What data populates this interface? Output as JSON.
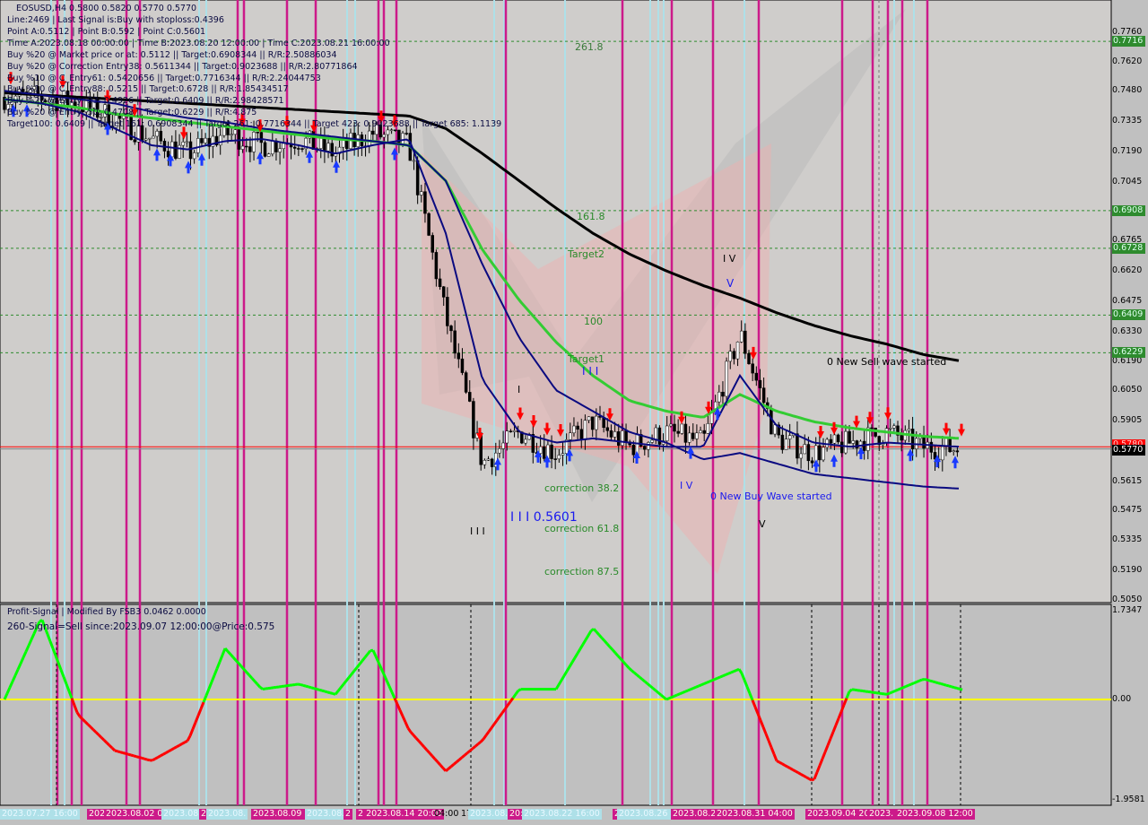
{
  "header": {
    "symbol_line": "EOSUSD,H4  0.5800 0.5820 0.5770 0.5770",
    "info_lines": [
      "Line:2469 | Last Signal is:Buy with stoploss:0.4396",
      "Point A:0.5112 | Point B:0.592 | Point C:0.5601",
      "Time A:2023.08.18 00:00:00 | Time B:2023.08.20 12:00:00 | Time C:2023.08.21 16:00:00",
      "Buy %20 @ Market price or at: 0.5112 || Target:0.6908344 || R/R:2.50886034",
      "Buy %20 @ Correction Entry38: 0.5611344 || Target:0.9023688 || R/R:2.80771864",
      "Buy %10 @ C_Entry61: 0.5420656 || Target:0.7716344 || R/R:2.24044753",
      "Buy %10 @ C_Entry88: 0.5215 || Target:0.6728 || R/R:1.85434517",
      "Buy %20 @ Entry -23: 0.4926 || Target:0.6409 || R/R:2.98428571",
      "Buy %20 @ Entry -50: 0.4708 || Target:0.6229 || R/R:4.875",
      "Target100: 0.6409 || Target 161: 0.6908344 || Target 261: 0.7716344 || Target 423: 0.9023688 || Target 685: 1.1139"
    ]
  },
  "annotations": {
    "fib_2618": "261.8",
    "fib_1618": "161.8",
    "target2": "Target2",
    "fib_100": "100",
    "target1": "Target1",
    "wave_iii_top": "I I I",
    "wave_i": "I",
    "correction_382": "correction 38.2",
    "wave_iii_point": "I I I 0.5601",
    "correction_618": "correction 61.8",
    "correction_875": "correction 87.5",
    "wave_iii_low": "I I I",
    "wave_iv_top": "I V",
    "wave_v_top": "V",
    "wave_iv_low": "I V",
    "new_buy_wave": "0 New Buy Wave started",
    "wave_v_low": "V",
    "new_sell_wave": "0 New Sell wave started"
  },
  "indicator": {
    "title": "Profit-Signal | Modified By FSB3 0.0462 0.0000",
    "signal_line": "260-Signal=Sell since:2023.09.07 12:00:00@Price:0.575",
    "axis_labels": [
      "1.7347",
      "0.00",
      "-1.9581"
    ]
  },
  "price_axis": {
    "ticks": [
      "0.7760",
      "0.7620",
      "0.7480",
      "0.7335",
      "0.7190",
      "0.7045",
      "0.6765",
      "0.6620",
      "0.6475",
      "0.6330",
      "0.6190",
      "0.6050",
      "0.5905",
      "0.5615",
      "0.5475",
      "0.5335",
      "0.5190",
      "0.5050"
    ],
    "level_labels": [
      "0.7716",
      "0.6908",
      "0.6728",
      "0.6409",
      "0.6229"
    ],
    "bid_label": "0.5780",
    "current_label": "0.5770"
  },
  "time_axis": {
    "labels": [
      {
        "text": "2023.07.27 16:00",
        "style": "cyan"
      },
      {
        "text": "2023.07.30 16:00",
        "style": "magenta"
      },
      {
        "text": "2023.08.02 08:00",
        "style": "magenta"
      },
      {
        "text": "2023.08.",
        "style": "cyan"
      },
      {
        "text": "202",
        "style": "magenta"
      },
      {
        "text": "2023.08.",
        "style": "cyan"
      },
      {
        "text": "2023.08.09 16:",
        "style": "magenta"
      },
      {
        "text": "2023.08.1",
        "style": "cyan"
      },
      {
        "text": "2",
        "style": "magenta"
      },
      {
        "text": "2 2023.08.14 20:00",
        "style": "magenta"
      },
      {
        "text": "04:00",
        "style": "plain"
      },
      {
        "text": "17",
        "style": "plain"
      },
      {
        "text": "2023.08.1",
        "style": "cyan"
      },
      {
        "text": "20: 2",
        "style": "magenta"
      },
      {
        "text": "2023.08.22 16:00",
        "style": "cyan"
      },
      {
        "text": "23.",
        "style": "magenta"
      },
      {
        "text": "2023.08.26 1",
        "style": "cyan"
      },
      {
        "text": "2023.08.29",
        "style": "magenta"
      },
      {
        "text": "2023.08.31 04:00",
        "style": "magenta"
      },
      {
        "text": "2023.09.04 20",
        "style": "magenta"
      },
      {
        "text": "2023.",
        "style": "magenta"
      },
      {
        "text": "2023.09.08 12:00",
        "style": "magenta"
      }
    ]
  },
  "chart_data": {
    "type": "candlestick",
    "symbol": "EOSUSD",
    "timeframe": "H4",
    "x_range": [
      "2023.07.27 16:00",
      "2023.09.08 12:00"
    ],
    "ylim": [
      0.505,
      0.776
    ],
    "grid": false,
    "close_approx": [
      0.745,
      0.745,
      0.742,
      0.735,
      0.725,
      0.718,
      0.728,
      0.722,
      0.725,
      0.718,
      0.728,
      0.722,
      0.64,
      0.57,
      0.585,
      0.575,
      0.59,
      0.578,
      0.585,
      0.58,
      0.632,
      0.582,
      0.575,
      0.58,
      0.585,
      0.578,
      0.577
    ],
    "moving_averages": [
      {
        "color": "#000000",
        "values": [
          0.747,
          0.746,
          0.745,
          0.744,
          0.743,
          0.742,
          0.741,
          0.74,
          0.739,
          0.738,
          0.737,
          0.736,
          0.73,
          0.718,
          0.705,
          0.692,
          0.68,
          0.67,
          0.662,
          0.655,
          0.649,
          0.642,
          0.636,
          0.631,
          0.627,
          0.622,
          0.619
        ]
      },
      {
        "color": "#33cc33",
        "values": [
          0.744,
          0.742,
          0.74,
          0.737,
          0.735,
          0.733,
          0.731,
          0.729,
          0.727,
          0.725,
          0.724,
          0.722,
          0.705,
          0.672,
          0.648,
          0.628,
          0.612,
          0.6,
          0.595,
          0.592,
          0.603,
          0.595,
          0.59,
          0.587,
          0.585,
          0.583,
          0.582
        ]
      },
      {
        "color": "#0a0a80",
        "values": [
          0.744,
          0.742,
          0.738,
          0.73,
          0.722,
          0.72,
          0.724,
          0.725,
          0.722,
          0.718,
          0.722,
          0.725,
          0.68,
          0.61,
          0.585,
          0.58,
          0.582,
          0.58,
          0.578,
          0.578,
          0.612,
          0.588,
          0.58,
          0.578,
          0.58,
          0.579,
          0.578
        ]
      },
      {
        "color": "#0a0a80",
        "values": [
          0.748,
          0.746,
          0.744,
          0.742,
          0.738,
          0.735,
          0.733,
          0.73,
          0.728,
          0.726,
          0.724,
          0.722,
          0.705,
          0.665,
          0.63,
          0.605,
          0.595,
          0.585,
          0.58,
          0.572,
          0.575,
          0.57,
          0.565,
          0.563,
          0.561,
          0.559,
          0.558
        ]
      }
    ],
    "levels": [
      0.7716,
      0.6908,
      0.6728,
      0.6409,
      0.6229
    ],
    "bid": 0.578,
    "last": 0.577,
    "oscillator": {
      "ylim": [
        -1.9581,
        1.7347
      ],
      "values": [
        0,
        1.6,
        -0.3,
        -1.0,
        -1.2,
        -0.8,
        1.0,
        0.2,
        0.3,
        0.1,
        1.0,
        -0.6,
        -1.4,
        -0.8,
        0.2,
        0.2,
        1.4,
        0.6,
        0.0,
        0.3,
        0.6,
        -1.2,
        -1.6,
        0.2,
        0.1,
        0.4,
        0.2
      ],
      "positive_color": "#00ff00",
      "negative_color": "#ff0000",
      "zero_color": "#ffff00"
    },
    "colors": {
      "level": "#2e8b2e",
      "bid_line": "#ff0000",
      "signal_line_magenta": "#cc1a8a",
      "signal_line_cyan": "#aee0e8"
    }
  }
}
